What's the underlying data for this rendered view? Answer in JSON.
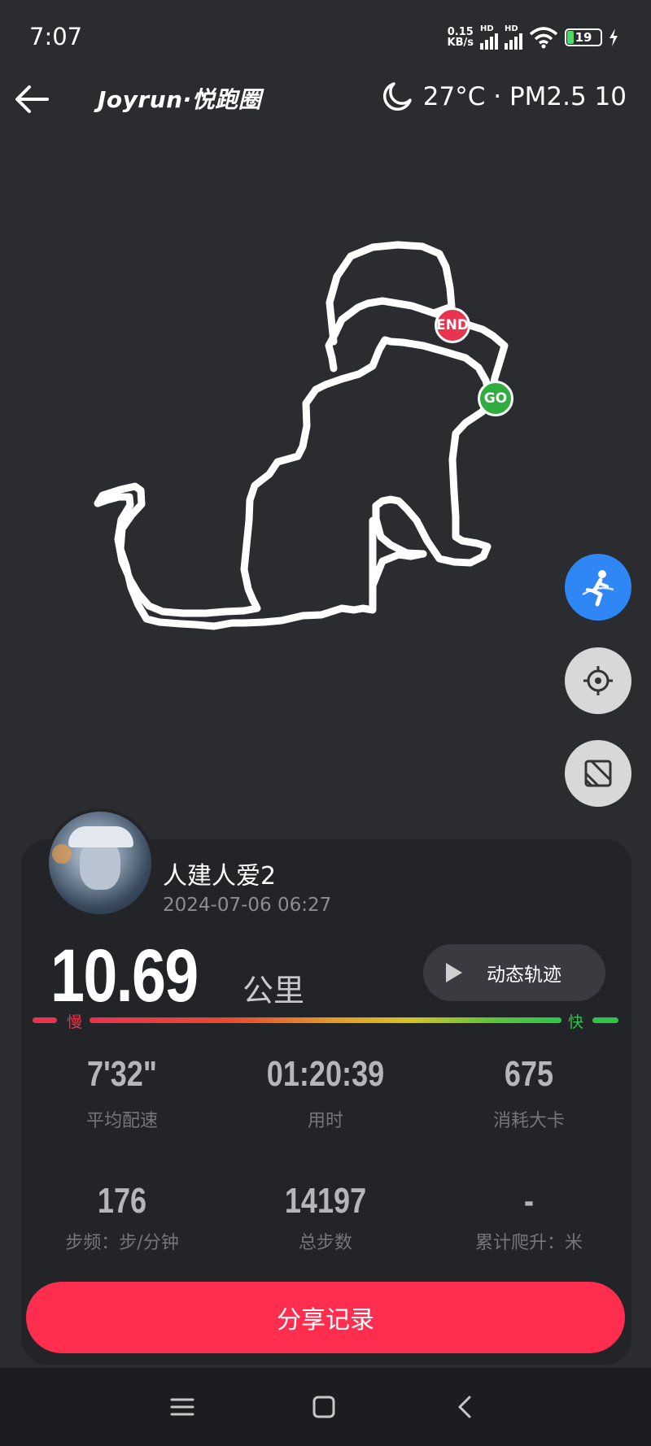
{
  "status_bar": {
    "time": "7:07",
    "net_speed_value": "0.15",
    "net_speed_unit": "KB/s",
    "hd_label": "HD",
    "battery": "19"
  },
  "header": {
    "brand": "Joyrun·悦跑圈",
    "weather": "27°C · PM2.5 10"
  },
  "map": {
    "end_label": "END",
    "go_label": "GO"
  },
  "card": {
    "username": "人建人爱2",
    "date": "2024-07-06 06:27",
    "distance_value": "10.69",
    "distance_unit": "公里",
    "replay_label": "动态轨迹",
    "pace_slow": "慢",
    "pace_fast": "快",
    "stats": [
      {
        "value": "7'32\"",
        "label": "平均配速"
      },
      {
        "value": "01:20:39",
        "label": "用时"
      },
      {
        "value": "675",
        "label": "消耗大卡"
      },
      {
        "value": "176",
        "label": "步频：步/分钟"
      },
      {
        "value": "14197",
        "label": "总步数"
      },
      {
        "value": "-",
        "label": "累计爬升：米"
      }
    ],
    "share_label": "分享记录"
  },
  "colors": {
    "background": "#2b2c30",
    "card": "#232428",
    "accent": "#ff2d4e",
    "run_button": "#2f86f5",
    "end_marker": "#e8344e",
    "go_marker": "#2fae3f"
  },
  "icons": [
    "back-arrow-icon",
    "moon-icon",
    "runner-icon",
    "locate-icon",
    "map-layer-icon",
    "play-icon",
    "menu-icon",
    "home-icon",
    "nav-back-icon"
  ]
}
